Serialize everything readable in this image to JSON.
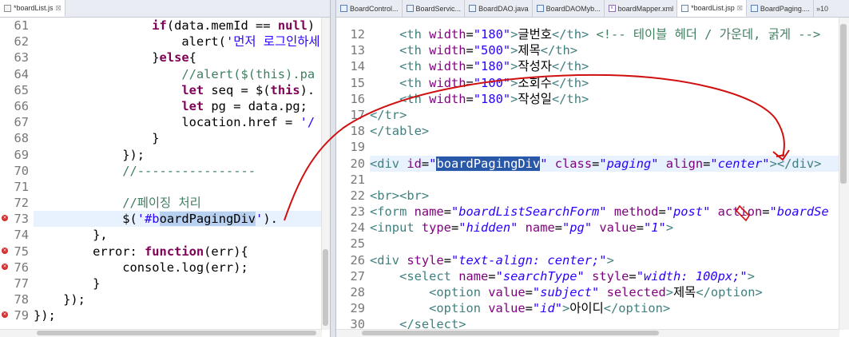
{
  "left_editor": {
    "tab_label": "*boardList.js",
    "tab_close": "☒",
    "lines": [
      {
        "n": "61",
        "tokens": [
          [
            "",
            "                "
          ],
          [
            "kw",
            "if"
          ],
          [
            "tx",
            "(data.memId == "
          ],
          [
            "kw",
            "null"
          ],
          [
            "tx",
            ")"
          ]
        ]
      },
      {
        "n": "62",
        "tokens": [
          [
            "",
            "                    "
          ],
          [
            "tx",
            "alert("
          ],
          [
            "str",
            "'먼저 로그인하세"
          ]
        ]
      },
      {
        "n": "63",
        "tokens": [
          [
            "",
            "                "
          ],
          [
            "tx",
            "}"
          ],
          [
            "kw",
            "else"
          ],
          [
            "tx",
            "{"
          ]
        ]
      },
      {
        "n": "64",
        "tokens": [
          [
            "",
            "                    "
          ],
          [
            "cmt",
            "//alert($(this).pa"
          ]
        ]
      },
      {
        "n": "65",
        "tokens": [
          [
            "",
            "                    "
          ],
          [
            "kw",
            "let"
          ],
          [
            "tx",
            " seq = $("
          ],
          [
            "kw",
            "this"
          ],
          [
            "tx",
            ")."
          ]
        ]
      },
      {
        "n": "66",
        "tokens": [
          [
            "",
            "                    "
          ],
          [
            "kw",
            "let"
          ],
          [
            "tx",
            " pg = data.pg;"
          ]
        ]
      },
      {
        "n": "67",
        "tokens": [
          [
            "",
            "                    "
          ],
          [
            "tx",
            "location.href = "
          ],
          [
            "str",
            "'/"
          ]
        ]
      },
      {
        "n": "68",
        "tokens": [
          [
            "",
            "                "
          ],
          [
            "tx",
            "}"
          ]
        ]
      },
      {
        "n": "69",
        "tokens": [
          [
            "",
            "            "
          ],
          [
            "tx",
            "});"
          ]
        ]
      },
      {
        "n": "70",
        "tokens": [
          [
            "",
            "            "
          ],
          [
            "cmt",
            "//----------------"
          ]
        ]
      },
      {
        "n": "71",
        "tokens": []
      },
      {
        "n": "72",
        "tokens": [
          [
            "",
            "            "
          ],
          [
            "cmt",
            "//페이징 처리"
          ]
        ]
      },
      {
        "n": "73",
        "tokens": [
          [
            "",
            "            "
          ],
          [
            "tx",
            "$("
          ],
          [
            "str",
            "'#b"
          ],
          [
            "hl",
            "oardPagingDiv"
          ],
          [
            "str",
            "'"
          ],
          [
            "tx",
            ")."
          ]
        ],
        "error": true,
        "current": true
      },
      {
        "n": "74",
        "tokens": [
          [
            "",
            "        "
          ],
          [
            "tx",
            "},"
          ]
        ]
      },
      {
        "n": "75",
        "tokens": [
          [
            "",
            "        "
          ],
          [
            "tx",
            "error: "
          ],
          [
            "kw",
            "function"
          ],
          [
            "tx",
            "(err){"
          ]
        ],
        "error": true
      },
      {
        "n": "76",
        "tokens": [
          [
            "",
            "            "
          ],
          [
            "tx",
            "console.log(err);"
          ]
        ],
        "error": true
      },
      {
        "n": "77",
        "tokens": [
          [
            "",
            "        "
          ],
          [
            "tx",
            "}"
          ]
        ]
      },
      {
        "n": "78",
        "tokens": [
          [
            "",
            "    "
          ],
          [
            "tx",
            "});"
          ]
        ]
      },
      {
        "n": "79",
        "tokens": [
          [
            "tx",
            "});"
          ]
        ],
        "error": true
      }
    ]
  },
  "right_editor": {
    "tabs": [
      {
        "label": "BoardControl...",
        "icon": "java-file-icon",
        "active": false
      },
      {
        "label": "BoardServic...",
        "icon": "java-file-icon",
        "active": false
      },
      {
        "label": "BoardDAO.java",
        "icon": "java-file-icon",
        "active": false
      },
      {
        "label": "BoardDAOMyb...",
        "icon": "java-file-icon",
        "active": false
      },
      {
        "label": "boardMapper.xml",
        "icon": "xml-file-icon",
        "active": false
      },
      {
        "label": "*boardList.jsp",
        "icon": "jsp-file-icon",
        "active": true
      },
      {
        "label": "BoardPaging....",
        "icon": "java-file-icon",
        "active": false
      }
    ],
    "tab_close": "☒",
    "tab_overflow": "»10",
    "lines": [
      {
        "n": "12",
        "tokens": [
          [
            "",
            "    "
          ],
          [
            "tag",
            "<th "
          ],
          [
            "attr",
            "width"
          ],
          [
            "tx",
            "="
          ],
          [
            "str",
            "\"180\""
          ],
          [
            "tag",
            ">"
          ],
          [
            "tx",
            "글번호"
          ],
          [
            "tag",
            "</th>"
          ],
          [
            "tx",
            " "
          ],
          [
            "cmt",
            "<!-- 테이블 헤더 / 가운데, 굵게 -->"
          ]
        ]
      },
      {
        "n": "13",
        "tokens": [
          [
            "",
            "    "
          ],
          [
            "tag",
            "<th "
          ],
          [
            "attr",
            "width"
          ],
          [
            "tx",
            "="
          ],
          [
            "str",
            "\"500\""
          ],
          [
            "tag",
            ">"
          ],
          [
            "tx",
            "제목"
          ],
          [
            "tag",
            "</th>"
          ]
        ]
      },
      {
        "n": "14",
        "tokens": [
          [
            "",
            "    "
          ],
          [
            "tag",
            "<th "
          ],
          [
            "attr",
            "width"
          ],
          [
            "tx",
            "="
          ],
          [
            "str",
            "\"180\""
          ],
          [
            "tag",
            ">"
          ],
          [
            "tx",
            "작성자"
          ],
          [
            "tag",
            "</th>"
          ]
        ]
      },
      {
        "n": "15",
        "tokens": [
          [
            "",
            "    "
          ],
          [
            "tag",
            "<th "
          ],
          [
            "attr",
            "width"
          ],
          [
            "tx",
            "="
          ],
          [
            "str",
            "\"100\""
          ],
          [
            "tag",
            ">"
          ],
          [
            "tx",
            "조회수"
          ],
          [
            "tag",
            "</th>"
          ]
        ]
      },
      {
        "n": "16",
        "tokens": [
          [
            "",
            "    "
          ],
          [
            "tag",
            "<th "
          ],
          [
            "attr",
            "width"
          ],
          [
            "tx",
            "="
          ],
          [
            "str",
            "\"180\""
          ],
          [
            "tag",
            ">"
          ],
          [
            "tx",
            "작성일"
          ],
          [
            "tag",
            "</th>"
          ]
        ]
      },
      {
        "n": "17",
        "tokens": [
          [
            "tag",
            "</tr>"
          ]
        ]
      },
      {
        "n": "18",
        "tokens": [
          [
            "tag",
            "</table>"
          ]
        ]
      },
      {
        "n": "19",
        "tokens": []
      },
      {
        "n": "20",
        "tokens": [
          [
            "tag",
            "<div "
          ],
          [
            "attr",
            "id"
          ],
          [
            "tx",
            "="
          ],
          [
            "val",
            "\""
          ],
          [
            "hl2",
            "boardPagingDiv"
          ],
          [
            "val",
            "\""
          ],
          [
            "tx",
            " "
          ],
          [
            "attr",
            "class"
          ],
          [
            "tx",
            "="
          ],
          [
            "val",
            "\"paging\""
          ],
          [
            "tx",
            " "
          ],
          [
            "attr",
            "align"
          ],
          [
            "tx",
            "="
          ],
          [
            "val",
            "\"center\""
          ],
          [
            "tag",
            "></div>"
          ]
        ],
        "current": true
      },
      {
        "n": "21",
        "tokens": []
      },
      {
        "n": "22",
        "tokens": [
          [
            "tag",
            "<br><br>"
          ]
        ]
      },
      {
        "n": "23",
        "tokens": [
          [
            "tag",
            "<form "
          ],
          [
            "attr",
            "name"
          ],
          [
            "tx",
            "="
          ],
          [
            "val",
            "\"boardListSearchForm\""
          ],
          [
            "tx",
            " "
          ],
          [
            "attr",
            "method"
          ],
          [
            "tx",
            "="
          ],
          [
            "val",
            "\"post\""
          ],
          [
            "tx",
            " "
          ],
          [
            "attr",
            "action"
          ],
          [
            "tx",
            "="
          ],
          [
            "val",
            "\"boardSe"
          ]
        ]
      },
      {
        "n": "24",
        "tokens": [
          [
            "tag",
            "<input "
          ],
          [
            "attr",
            "type"
          ],
          [
            "tx",
            "="
          ],
          [
            "val",
            "\"hidden\""
          ],
          [
            "tx",
            " "
          ],
          [
            "attr",
            "name"
          ],
          [
            "tx",
            "="
          ],
          [
            "val",
            "\"pg\""
          ],
          [
            "tx",
            " "
          ],
          [
            "attr",
            "value"
          ],
          [
            "tx",
            "="
          ],
          [
            "val",
            "\"1\""
          ],
          [
            "tag",
            ">"
          ]
        ]
      },
      {
        "n": "25",
        "tokens": []
      },
      {
        "n": "26",
        "tokens": [
          [
            "tag",
            "<div "
          ],
          [
            "attr",
            "style"
          ],
          [
            "tx",
            "="
          ],
          [
            "val",
            "\"text-align: center;\""
          ],
          [
            "tag",
            ">"
          ]
        ]
      },
      {
        "n": "27",
        "tokens": [
          [
            "",
            "    "
          ],
          [
            "tag",
            "<select "
          ],
          [
            "attr",
            "name"
          ],
          [
            "tx",
            "="
          ],
          [
            "val",
            "\"searchType\""
          ],
          [
            "tx",
            " "
          ],
          [
            "attr",
            "style"
          ],
          [
            "tx",
            "="
          ],
          [
            "val",
            "\"width: 100px;\""
          ],
          [
            "tag",
            ">"
          ]
        ]
      },
      {
        "n": "28",
        "tokens": [
          [
            "",
            "        "
          ],
          [
            "tag",
            "<option "
          ],
          [
            "attr",
            "value"
          ],
          [
            "tx",
            "="
          ],
          [
            "val",
            "\"subject\""
          ],
          [
            "tx",
            " "
          ],
          [
            "attr",
            "selected"
          ],
          [
            "tag",
            ">"
          ],
          [
            "tx",
            "제목"
          ],
          [
            "tag",
            "</option>"
          ]
        ]
      },
      {
        "n": "29",
        "tokens": [
          [
            "",
            "        "
          ],
          [
            "tag",
            "<option "
          ],
          [
            "attr",
            "value"
          ],
          [
            "tx",
            "="
          ],
          [
            "val",
            "\"id\""
          ],
          [
            "tag",
            ">"
          ],
          [
            "tx",
            "아이디"
          ],
          [
            "tag",
            "</option>"
          ]
        ]
      },
      {
        "n": "30",
        "tokens": [
          [
            "",
            "    "
          ],
          [
            "tag",
            "</select>"
          ]
        ]
      }
    ]
  },
  "colors": {
    "keyword": "#7f0055",
    "string": "#2a00ff",
    "comment": "#3f7f5f",
    "tag": "#3f7f7f",
    "attribute": "#7f007f",
    "selection": "#b8d1f0",
    "current_line": "#e8f2fe",
    "error_marker": "#d3302f",
    "annotation_ink": "#d01010"
  }
}
